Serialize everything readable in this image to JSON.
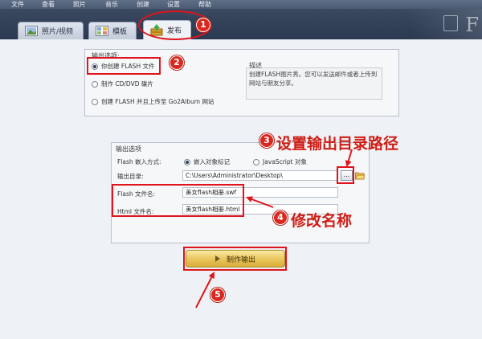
{
  "menu": [
    "文件",
    "查看",
    "照片",
    "音乐",
    "创建",
    "设置",
    "帮助"
  ],
  "tabs": [
    {
      "label": "照片/视频",
      "icon": "photo-video-icon",
      "active": false
    },
    {
      "label": "模板",
      "icon": "template-icon",
      "active": false
    },
    {
      "label": "发布",
      "icon": "publish-icon",
      "active": true
    }
  ],
  "output_options": {
    "title": "输出选项:",
    "options": [
      {
        "label": "你创建 FLASH 文件",
        "selected": true
      },
      {
        "label": "制作 CD/DVD 碟片",
        "selected": false
      },
      {
        "label": "创建 FLASH 并且上传至 Go2Album 网站",
        "selected": false
      }
    ],
    "desc_title": "描述",
    "desc_lines": [
      "创建FLASH图片秀。您可以发送邮件或者上传到",
      "网站与朋友分享。"
    ]
  },
  "output_settings": {
    "title": "输出选项",
    "embed_label": "Flash 嵌入方式:",
    "embed_options": [
      {
        "label": "嵌入对象标记",
        "selected": true
      },
      {
        "label": "JavaScript 对象",
        "selected": false
      }
    ],
    "dir_label": "输出目录:",
    "dir_value": "C:\\Users\\Administrator\\Desktop\\",
    "browse_label": "...",
    "flash_label": "Flash 文件名:",
    "flash_value": "美女flash相册.swf",
    "html_label": "Html 文件名:",
    "html_value": "美女flash相册.html"
  },
  "make_button": "制作输出",
  "annotations": {
    "steps": [
      "1",
      "2",
      "3",
      "4",
      "5"
    ],
    "step3_text": "设置输出目录路径",
    "step4_text": "修改名称",
    "color": "#e0141c"
  },
  "colors": {
    "menubar": "#4a5a72",
    "tabstrip": "#2a3850",
    "content_bg": "#eef1f5",
    "accent_button": "#e9c45a"
  }
}
